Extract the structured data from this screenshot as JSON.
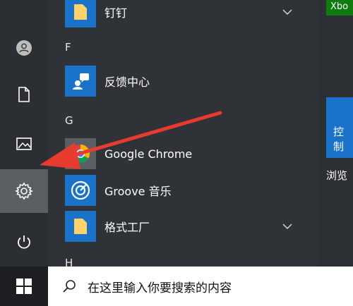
{
  "applist": {
    "items": [
      {
        "type": "app",
        "label": "钉钉",
        "icon": "folder-icon",
        "expandable": true
      },
      {
        "type": "letter",
        "label": "F"
      },
      {
        "type": "app",
        "label": "反馈中心",
        "icon": "feedback-hub-icon",
        "expandable": false
      },
      {
        "type": "letter",
        "label": "G"
      },
      {
        "type": "app",
        "label": "Google Chrome",
        "icon": "chrome-icon",
        "expandable": false
      },
      {
        "type": "app",
        "label": "Groove 音乐",
        "icon": "groove-music-icon",
        "expandable": false
      },
      {
        "type": "app",
        "label": "格式工厂",
        "icon": "folder-icon",
        "expandable": true
      },
      {
        "type": "letter",
        "label": "H"
      }
    ]
  },
  "rail": {
    "items": [
      {
        "name": "user-icon"
      },
      {
        "name": "documents-icon"
      },
      {
        "name": "pictures-icon"
      },
      {
        "name": "settings-icon",
        "active": true
      },
      {
        "name": "power-icon"
      }
    ]
  },
  "tiles": {
    "xbox_label": "Xbo",
    "control_label": "控制",
    "browse_label": "浏览"
  },
  "taskbar": {
    "search_placeholder": "在这里输入你要搜索的内容"
  },
  "colors": {
    "accent": "#1a73c8",
    "xbox_green": "#107c10",
    "arrow_red": "#e63b2e",
    "folder_yellow": "#fcd36b"
  }
}
